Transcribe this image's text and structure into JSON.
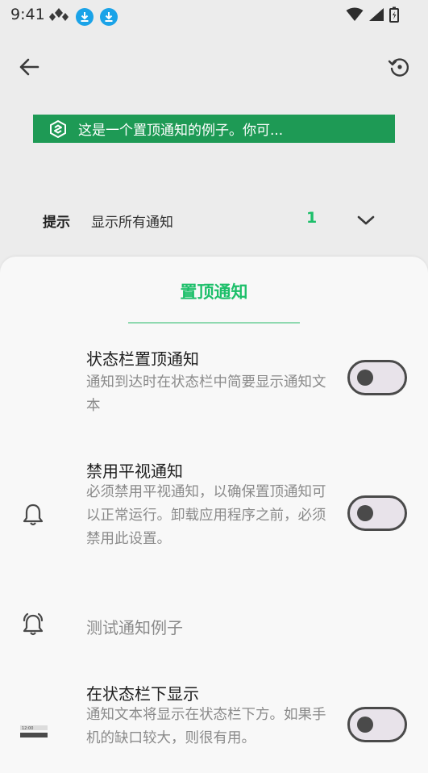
{
  "status": {
    "time": "9:41"
  },
  "preview": {
    "text": "这是一个置顶通知的例子。你可..."
  },
  "filter": {
    "label": "提示",
    "value": "显示所有通知",
    "count": "1"
  },
  "sheet": {
    "title": "置顶通知",
    "settings": [
      {
        "title": "状态栏置顶通知",
        "desc": "通知到达时在状态栏中简要显示通知文本",
        "enabled": false
      },
      {
        "title": "禁用平视通知",
        "desc": "必须禁用平视通知，以确保置顶通知可以正常运行。卸载应用程序之前，必须禁用此设置。",
        "enabled": false
      },
      {
        "title": "在状态栏下显示",
        "desc": "通知文本将显示在状态栏下方。如果手机的缺口较大，则很有用。",
        "enabled": false
      }
    ],
    "test_label": "测试通知例子"
  },
  "colors": {
    "accent": "#1dbf6a",
    "preview_bg": "#1e9a55",
    "download_badge": "#1aa3e8"
  },
  "icons": {
    "back": "arrow-left-icon",
    "restore": "restore-icon",
    "chevron": "chevron-down-icon",
    "bell": "bell-icon",
    "bell_ring": "bell-ring-icon",
    "statusbar": "statusbar-preview-icon"
  }
}
